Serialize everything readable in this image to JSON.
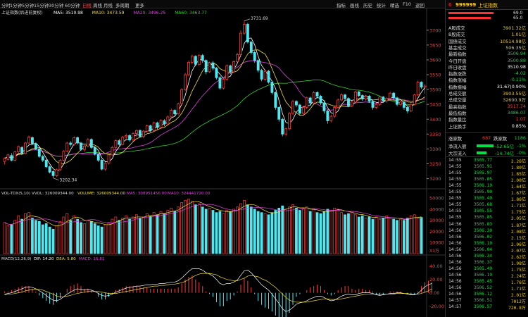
{
  "toolbar": {
    "periods": [
      "分时",
      "1分钟",
      "5分钟",
      "15分钟",
      "30分钟",
      "60分钟",
      "日线",
      "周线",
      "月线",
      "多周期",
      "更多"
    ],
    "active_period": "日线",
    "menus": [
      "指标",
      "画线",
      "历史",
      "统计",
      "精选",
      "F10",
      "返回"
    ]
  },
  "chart": {
    "stock_label": "上证指数(后进前复权)",
    "ma_legend": {
      "ma5": "MA5: 3510.98",
      "ma10": "MA10: 3473.59",
      "ma20": "MA20: 3496.25",
      "ma60": "MA60: 3463.77"
    },
    "price_ticks": [
      "3700",
      "3650",
      "3600",
      "3550",
      "3500",
      "3450",
      "3400",
      "3350",
      "3300",
      "3250",
      "3200"
    ],
    "high_marker": "3731.69",
    "low_marker": "3202.34",
    "vol_legend": {
      "label": "VOL-TDX(5,10)",
      "vvol": "VVOL: 326009344.00",
      "volume": "VOLUME: 326009344.00",
      "ma5": "MA5: 308951456.00",
      "ma10": "MA10: 324441720.00"
    },
    "vol_ticks": [
      "50000",
      "40000",
      "30000",
      "20000",
      "10000"
    ],
    "vol_unit": "X1万",
    "macd_legend": {
      "label": "MACD(12,26,9)",
      "dif": "DIF: 14.20",
      "dea": "DEA: 5.80",
      "macd": "MACD: 16.81"
    },
    "macd_ticks": [
      "40.00",
      "20.00",
      "0.00",
      "-20.00"
    ]
  },
  "colors": {
    "up": "#ff3b3b",
    "down": "#4ee8f0",
    "ma5": "#ffffff",
    "ma10": "#f0e030",
    "ma20": "#e040e0",
    "ma60": "#30d030"
  },
  "quote": {
    "code": "999999",
    "name": "上证指数",
    "top_pct1": "69.0",
    "top_pct2": "65.0",
    "stats": [
      {
        "k": "A股成交",
        "v": "3901.32亿",
        "c": "#f0d000"
      },
      {
        "k": "B股成交",
        "v": "1.01亿",
        "c": "#f0d000"
      },
      {
        "k": "国债成交",
        "v": "10514.98亿",
        "c": "#f0d000"
      },
      {
        "k": "基金成交",
        "v": "506.35亿",
        "c": "#f0d000"
      },
      {
        "k": "最新指数",
        "v": "3506.94",
        "c": "#00e040"
      },
      {
        "k": "今日开盘",
        "v": "3500.88",
        "c": "#00e040"
      },
      {
        "k": "昨日收盘",
        "v": "3510.98",
        "c": "#ffffff"
      },
      {
        "k": "指数涨跌",
        "v": "-4.02",
        "c": "#00e040"
      },
      {
        "k": "指数涨幅",
        "v": "-0.11%",
        "c": "#00e040"
      },
      {
        "k": "指数振幅",
        "v": "31.67(0.90%",
        "c": "#ffffff"
      },
      {
        "k": "总成交额",
        "v": "3903.55亿",
        "c": "#f0d000"
      },
      {
        "k": "总成交量",
        "v": "32600.9万",
        "c": "#f0d000"
      },
      {
        "k": "最高指数",
        "v": "3517.74",
        "c": "#ff3b3b"
      },
      {
        "k": "最低指数",
        "v": "3486.07",
        "c": "#00e040"
      },
      {
        "k": "指数量比",
        "v": "1.07",
        "c": "#ff3b3b"
      },
      {
        "k": "上证换手",
        "v": "0.85%",
        "c": "#ffffff"
      }
    ],
    "updown": {
      "up_label": "涨家数",
      "up_val": "687",
      "down_label": "跌家数",
      "down_val": "1186"
    },
    "flows": [
      {
        "k": "净流入额",
        "v": "-52.65亿",
        "p": "-1%"
      },
      {
        "k": "大宗流入",
        "v": "-14.74亿",
        "p": "-0%"
      }
    ],
    "ticks": [
      {
        "t": "14:55",
        "p": "3505.77",
        "v": "2.26亿"
      },
      {
        "t": "14:55",
        "p": "3505.91",
        "v": "1.80亿"
      },
      {
        "t": "14:55",
        "p": "3505.97",
        "v": "1.85亿"
      },
      {
        "t": "14:55",
        "p": "3505.85",
        "v": "2.00亿"
      },
      {
        "t": "14:55",
        "p": "3506.19",
        "v": "1.64亿"
      },
      {
        "t": "14:55",
        "p": "3505.90",
        "v": "1.67亿"
      },
      {
        "t": "14:55",
        "p": "3505.49",
        "v": "1.86亿"
      },
      {
        "t": "14:55",
        "p": "3505.68",
        "v": "1.71亿"
      },
      {
        "t": "14:55",
        "p": "3505.55",
        "v": "1.75亿"
      },
      {
        "t": "14:55",
        "p": "3505.85",
        "v": "2.05亿"
      },
      {
        "t": "14:56",
        "p": "3505.83",
        "v": "1.87亿"
      },
      {
        "t": "14:56",
        "p": "3506.30",
        "v": "2.08亿"
      },
      {
        "t": "14:56",
        "p": "3506.02",
        "v": "2.15亿"
      },
      {
        "t": "14:56",
        "p": "3506.10",
        "v": "2.06亿"
      },
      {
        "t": "14:56",
        "p": "3506.04",
        "v": "2.07亿"
      },
      {
        "t": "14:56",
        "p": "3506.34",
        "v": "2.62亿"
      },
      {
        "t": "14:56",
        "p": "3506.37",
        "v": "1.98亿"
      },
      {
        "t": "14:56",
        "p": "3505.49",
        "v": "1.75亿"
      },
      {
        "t": "14:56",
        "p": "3506.19",
        "v": "2.24亿"
      },
      {
        "t": "14:56",
        "p": "3505.45",
        "v": "1.76亿"
      },
      {
        "t": "14:56",
        "p": "3506.52",
        "v": "1.71亿"
      },
      {
        "t": "14:56",
        "p": "3506.12",
        "v": "2.01亿"
      },
      {
        "t": "14:57",
        "p": "3506.51",
        "v": "7012万"
      },
      {
        "t": "14:57",
        "p": "3506.57",
        "v": "720.8万"
      }
    ]
  },
  "chart_data": {
    "type": "candlestick",
    "ylim": [
      3180,
      3740
    ],
    "candles": [
      [
        3258,
        3268,
        3248,
        3272
      ],
      [
        3265,
        3280,
        3262,
        3284
      ],
      [
        3278,
        3262,
        3258,
        3286
      ],
      [
        3262,
        3290,
        3258,
        3294
      ],
      [
        3290,
        3308,
        3286,
        3312
      ],
      [
        3305,
        3285,
        3280,
        3310
      ],
      [
        3285,
        3320,
        3282,
        3324
      ],
      [
        3320,
        3340,
        3316,
        3345
      ],
      [
        3338,
        3318,
        3312,
        3342
      ],
      [
        3318,
        3300,
        3296,
        3322
      ],
      [
        3300,
        3275,
        3270,
        3304
      ],
      [
        3275,
        3262,
        3256,
        3280
      ],
      [
        3262,
        3240,
        3235,
        3266
      ],
      [
        3240,
        3222,
        3218,
        3244
      ],
      [
        3224,
        3210,
        3202,
        3228
      ],
      [
        3210,
        3230,
        3206,
        3234
      ],
      [
        3230,
        3262,
        3226,
        3266
      ],
      [
        3262,
        3292,
        3258,
        3296
      ],
      [
        3292,
        3320,
        3288,
        3324
      ],
      [
        3320,
        3315,
        3308,
        3326
      ],
      [
        3315,
        3338,
        3310,
        3342
      ],
      [
        3338,
        3320,
        3315,
        3342
      ],
      [
        3320,
        3298,
        3294,
        3324
      ],
      [
        3298,
        3310,
        3290,
        3314
      ],
      [
        3310,
        3332,
        3306,
        3336
      ],
      [
        3332,
        3305,
        3300,
        3336
      ],
      [
        3305,
        3282,
        3278,
        3308
      ],
      [
        3282,
        3262,
        3256,
        3286
      ],
      [
        3262,
        3232,
        3228,
        3266
      ],
      [
        3232,
        3252,
        3226,
        3256
      ],
      [
        3252,
        3280,
        3248,
        3284
      ],
      [
        3280,
        3305,
        3276,
        3310
      ],
      [
        3305,
        3328,
        3300,
        3332
      ],
      [
        3328,
        3315,
        3310,
        3334
      ],
      [
        3315,
        3340,
        3312,
        3344
      ],
      [
        3340,
        3345,
        3328,
        3352
      ],
      [
        3345,
        3330,
        3324,
        3350
      ],
      [
        3330,
        3352,
        3326,
        3356
      ],
      [
        3352,
        3362,
        3340,
        3366
      ],
      [
        3362,
        3342,
        3338,
        3366
      ],
      [
        3342,
        3360,
        3336,
        3364
      ],
      [
        3360,
        3378,
        3354,
        3382
      ],
      [
        3378,
        3362,
        3356,
        3382
      ],
      [
        3362,
        3388,
        3358,
        3392
      ],
      [
        3388,
        3372,
        3366,
        3392
      ],
      [
        3372,
        3395,
        3368,
        3400
      ],
      [
        3395,
        3384,
        3376,
        3400
      ],
      [
        3384,
        3408,
        3380,
        3412
      ],
      [
        3408,
        3430,
        3402,
        3436
      ],
      [
        3430,
        3418,
        3410,
        3434
      ],
      [
        3418,
        3452,
        3414,
        3456
      ],
      [
        3452,
        3500,
        3448,
        3505
      ],
      [
        3500,
        3550,
        3494,
        3556
      ],
      [
        3550,
        3592,
        3544,
        3598
      ],
      [
        3592,
        3612,
        3585,
        3618
      ],
      [
        3612,
        3585,
        3578,
        3616
      ],
      [
        3585,
        3615,
        3580,
        3620
      ],
      [
        3615,
        3598,
        3590,
        3620
      ],
      [
        3598,
        3560,
        3552,
        3602
      ],
      [
        3560,
        3590,
        3556,
        3594
      ],
      [
        3590,
        3572,
        3565,
        3596
      ],
      [
        3572,
        3540,
        3534,
        3576
      ],
      [
        3540,
        3505,
        3500,
        3545
      ],
      [
        3505,
        3535,
        3500,
        3540
      ],
      [
        3535,
        3580,
        3530,
        3585
      ],
      [
        3580,
        3560,
        3552,
        3584
      ],
      [
        3560,
        3594,
        3555,
        3598
      ],
      [
        3594,
        3618,
        3588,
        3624
      ],
      [
        3618,
        3690,
        3612,
        3700
      ],
      [
        3690,
        3720,
        3684,
        3731
      ],
      [
        3720,
        3660,
        3655,
        3725
      ],
      [
        3660,
        3625,
        3618,
        3665
      ],
      [
        3625,
        3598,
        3590,
        3630
      ],
      [
        3598,
        3565,
        3558,
        3602
      ],
      [
        3565,
        3535,
        3528,
        3570
      ],
      [
        3535,
        3562,
        3530,
        3566
      ],
      [
        3562,
        3525,
        3520,
        3566
      ],
      [
        3525,
        3490,
        3484,
        3530
      ],
      [
        3490,
        3440,
        3432,
        3494
      ],
      [
        3440,
        3400,
        3392,
        3445
      ],
      [
        3400,
        3350,
        3342,
        3405
      ],
      [
        3350,
        3368,
        3344,
        3372
      ],
      [
        3368,
        3420,
        3362,
        3424
      ],
      [
        3420,
        3460,
        3414,
        3466
      ],
      [
        3460,
        3448,
        3440,
        3464
      ],
      [
        3448,
        3420,
        3412,
        3452
      ],
      [
        3420,
        3440,
        3414,
        3446
      ],
      [
        3440,
        3472,
        3434,
        3476
      ],
      [
        3472,
        3455,
        3448,
        3476
      ],
      [
        3455,
        3490,
        3450,
        3495
      ],
      [
        3490,
        3478,
        3470,
        3494
      ],
      [
        3478,
        3455,
        3448,
        3482
      ],
      [
        3455,
        3428,
        3420,
        3460
      ],
      [
        3428,
        3395,
        3385,
        3432
      ],
      [
        3395,
        3410,
        3390,
        3416
      ],
      [
        3410,
        3440,
        3404,
        3446
      ],
      [
        3440,
        3465,
        3436,
        3470
      ],
      [
        3465,
        3482,
        3460,
        3488
      ],
      [
        3482,
        3470,
        3464,
        3486
      ],
      [
        3470,
        3445,
        3440,
        3474
      ],
      [
        3445,
        3458,
        3440,
        3462
      ],
      [
        3458,
        3492,
        3454,
        3496
      ],
      [
        3492,
        3480,
        3474,
        3496
      ],
      [
        3480,
        3468,
        3462,
        3484
      ],
      [
        3468,
        3478,
        3462,
        3482
      ],
      [
        3478,
        3460,
        3455,
        3482
      ],
      [
        3460,
        3440,
        3432,
        3464
      ],
      [
        3440,
        3450,
        3435,
        3454
      ],
      [
        3450,
        3475,
        3446,
        3480
      ],
      [
        3475,
        3462,
        3456,
        3478
      ],
      [
        3462,
        3470,
        3456,
        3474
      ],
      [
        3470,
        3488,
        3466,
        3492
      ],
      [
        3488,
        3472,
        3466,
        3492
      ],
      [
        3472,
        3450,
        3444,
        3476
      ],
      [
        3450,
        3458,
        3444,
        3462
      ],
      [
        3458,
        3440,
        3432,
        3462
      ],
      [
        3440,
        3428,
        3420,
        3444
      ],
      [
        3428,
        3450,
        3424,
        3454
      ],
      [
        3450,
        3482,
        3446,
        3486
      ],
      [
        3482,
        3525,
        3478,
        3530
      ],
      [
        3525,
        3508,
        3502,
        3528
      ],
      [
        3508,
        3512,
        3486,
        3518
      ]
    ],
    "volume": [
      28000,
      25000,
      26000,
      30000,
      34000,
      31000,
      36000,
      37000,
      32000,
      30000,
      29000,
      26000,
      27000,
      24000,
      22000,
      25000,
      29000,
      33000,
      36000,
      30000,
      34000,
      31000,
      28000,
      27000,
      30000,
      29000,
      27000,
      25000,
      24000,
      26000,
      28000,
      31000,
      33000,
      30000,
      32000,
      34000,
      31000,
      33000,
      35000,
      32000,
      33000,
      36000,
      34000,
      37000,
      35000,
      38000,
      36000,
      39000,
      41000,
      38000,
      42000,
      46000,
      48000,
      49000,
      47000,
      44000,
      45000,
      42000,
      40000,
      41000,
      39000,
      37000,
      38000,
      36000,
      39000,
      38000,
      40000,
      42000,
      45000,
      48000,
      44000,
      42000,
      40000,
      38000,
      37000,
      36000,
      35000,
      37000,
      39000,
      41000,
      43000,
      40000,
      42000,
      44000,
      41000,
      39000,
      40000,
      42000,
      38000,
      40000,
      37000,
      36000,
      38000,
      40000,
      39000,
      41000,
      40000,
      37000,
      35000,
      36000,
      38000,
      35000,
      33000,
      34000,
      32000,
      33000,
      31000,
      33000,
      31000,
      32000,
      34000,
      32000,
      31000,
      30000,
      31000,
      30000,
      32000,
      34000,
      35000,
      32000,
      32600
    ],
    "dif": [
      -2,
      -1,
      0,
      2,
      4,
      6,
      8,
      9,
      8,
      6,
      3,
      0,
      -4,
      -8,
      -11,
      -12,
      -10,
      -6,
      -2,
      1,
      4,
      6,
      5,
      4,
      5,
      4,
      2,
      -1,
      -4,
      -5,
      -4,
      -2,
      1,
      3,
      5,
      7,
      8,
      9,
      10,
      10,
      11,
      12,
      12,
      13,
      13,
      14,
      14,
      15,
      16,
      16,
      18,
      22,
      27,
      32,
      36,
      36,
      36,
      34,
      30,
      28,
      25,
      20,
      14,
      12,
      14,
      14,
      16,
      19,
      26,
      33,
      34,
      30,
      24,
      18,
      12,
      8,
      4,
      -2,
      -9,
      -16,
      -24,
      -28,
      -26,
      -22,
      -17,
      -15,
      -14,
      -12,
      -9,
      -7,
      -5,
      -5,
      -7,
      -10,
      -12,
      -11,
      -8,
      -5,
      -3,
      -2,
      -3,
      -3,
      -1,
      0,
      0,
      0,
      -1,
      -3,
      -4,
      -3,
      -2,
      -1,
      -1,
      0,
      0,
      -1,
      -2,
      -3,
      -3,
      -1,
      4,
      9,
      12,
      14
    ],
    "dea": [
      -3,
      -2,
      -2,
      -1,
      0,
      1,
      3,
      4,
      5,
      5,
      5,
      4,
      2,
      0,
      -2,
      -5,
      -6,
      -6,
      -5,
      -4,
      -2,
      -1,
      0,
      1,
      2,
      2,
      2,
      2,
      1,
      0,
      -1,
      -1,
      -1,
      0,
      1,
      2,
      3,
      4,
      5,
      6,
      7,
      8,
      9,
      10,
      10,
      11,
      11,
      12,
      13,
      13,
      14,
      15,
      17,
      20,
      23,
      26,
      28,
      29,
      29,
      29,
      28,
      27,
      24,
      22,
      20,
      19,
      18,
      18,
      20,
      22,
      25,
      26,
      25,
      24,
      21,
      19,
      16,
      12,
      8,
      3,
      -2,
      -7,
      -11,
      -13,
      -14,
      -14,
      -14,
      -14,
      -13,
      -12,
      -11,
      -10,
      -9,
      -9,
      -10,
      -10,
      -10,
      -9,
      -8,
      -7,
      -6,
      -5,
      -4,
      -3,
      -2,
      -2,
      -2,
      -2,
      -2,
      -2,
      -2,
      -2,
      -2,
      -1,
      -1,
      -1,
      -1,
      -2,
      -2,
      -2,
      -1,
      1,
      3,
      6
    ]
  }
}
